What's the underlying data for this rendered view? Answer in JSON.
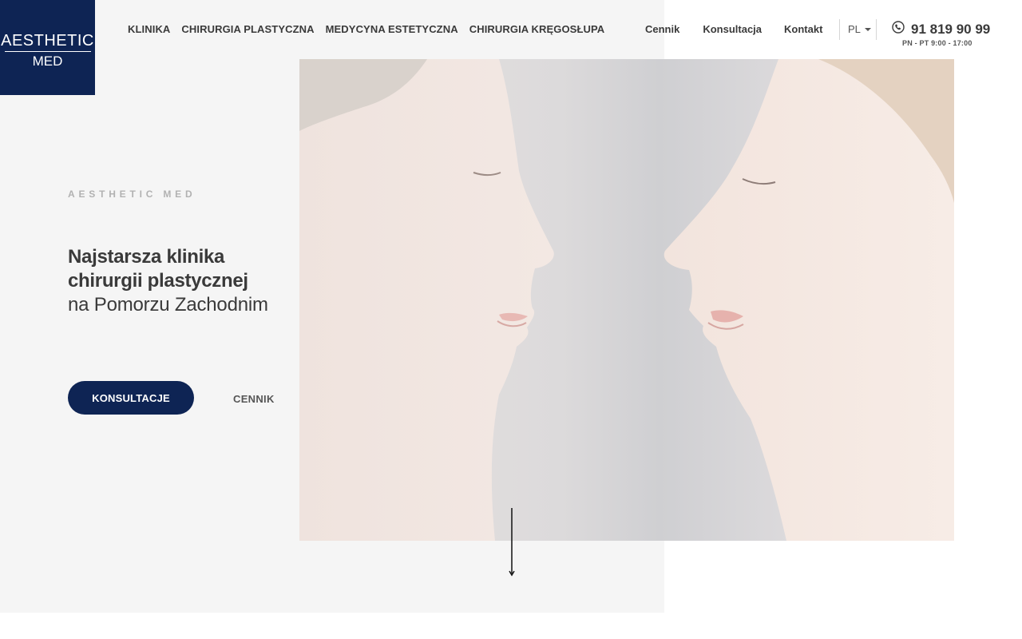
{
  "logo": {
    "line1": "AESTHETIC",
    "line2": "MED"
  },
  "nav": {
    "main": [
      {
        "label": "KLINIKA"
      },
      {
        "label": "CHIRURGIA PLASTYCZNA"
      },
      {
        "label": "MEDYCYNA ESTETYCZNA"
      },
      {
        "label": "CHIRURGIA KRĘGOSŁUPA"
      }
    ],
    "secondary": [
      {
        "label": "Cennik"
      },
      {
        "label": "Konsultacja"
      },
      {
        "label": "Kontakt"
      }
    ]
  },
  "language": {
    "selected": "PL"
  },
  "phone": {
    "number": "91 819 90 99",
    "hours": "PN - PT 9:00 - 17:00"
  },
  "hero": {
    "eyebrow": "AESTHETIC MED",
    "headline_line1": "Najstarsza klinika",
    "headline_line2": "chirurgii plastycznej",
    "headline_line3": "na Pomorzu Zachodnim",
    "primary_button": "KONSULTACJE",
    "secondary_button": "CENNIK"
  },
  "colors": {
    "brand_navy": "#0e2454",
    "panel_background": "#f5f5f5",
    "text_dark": "#3a3a3a",
    "eyebrow_gray": "#b2b2b2"
  },
  "icons": {
    "phone": "phone-icon",
    "caret": "chevron-down-icon",
    "scroll": "arrow-down-icon"
  }
}
